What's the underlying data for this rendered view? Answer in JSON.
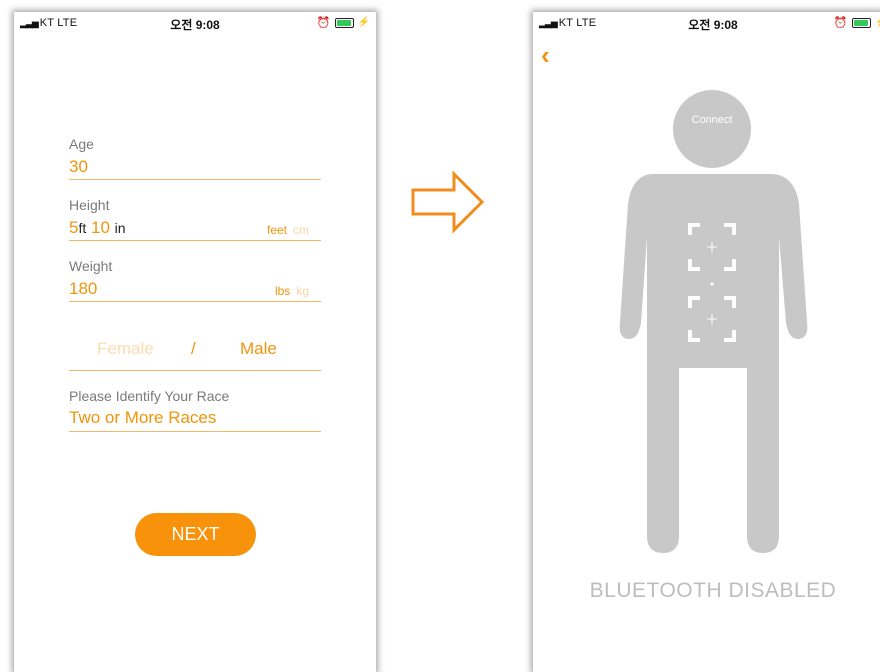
{
  "left_screen": {
    "status": {
      "carrier": "KT  LTE",
      "time": "오전 9:08"
    },
    "age": {
      "label": "Age",
      "value": "30"
    },
    "height": {
      "label": "Height",
      "feet": "5",
      "feet_unit": "ft",
      "inches": "10",
      "inch_unit": "in",
      "unit_feet": "feet",
      "unit_cm": "cm"
    },
    "weight": {
      "label": "Weight",
      "value": "180",
      "unit_lbs": "lbs",
      "unit_kg": "kg"
    },
    "gender": {
      "female": "Female",
      "separator": "/",
      "male": "Male"
    },
    "race": {
      "label": "Please Identify Your Race",
      "value": "Two or More Races"
    },
    "next_label": "NEXT"
  },
  "right_screen": {
    "status": {
      "carrier": "KT  LTE",
      "time": "오전 9:08"
    },
    "connect_label": "Connect",
    "bluetooth_status": "BLUETOOTH DISABLED"
  },
  "colors": {
    "accent": "#f7920a",
    "figure": "#c8c8c8",
    "label_gray": "#7a7a7a"
  }
}
